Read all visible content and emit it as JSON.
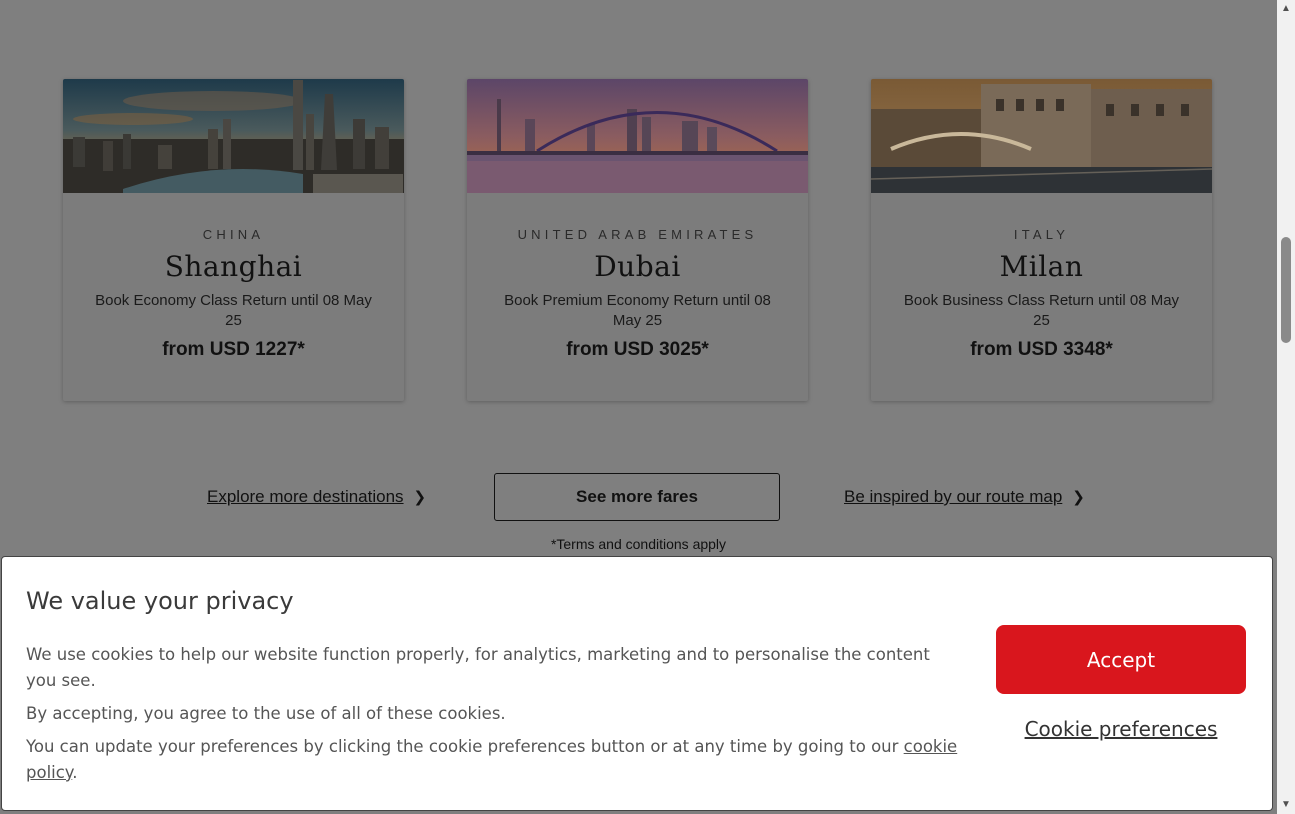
{
  "cards": [
    {
      "country": "CHINA",
      "city": "Shanghai",
      "description": "Book Economy Class Return until 08 May 25",
      "price": "from USD 1227*",
      "image": "shanghai-skyline-image"
    },
    {
      "country": "UNITED ARAB EMIRATES",
      "city": "Dubai",
      "description": "Book Premium Economy Return until 08 May 25",
      "price": "from USD 3025*",
      "image": "dubai-bridge-image"
    },
    {
      "country": "ITALY",
      "city": "Milan",
      "description": "Book Business Class Return until 08 May 25",
      "price": "from USD 3348*",
      "image": "milan-canal-image"
    }
  ],
  "links": {
    "explore": "Explore more destinations",
    "see_more": "See more fares",
    "route_map": "Be inspired by our route map",
    "chevron_icon": "chevron-right-icon"
  },
  "terms": "*Terms and conditions apply",
  "cookie": {
    "title": "We value your privacy",
    "p1": "We use cookies to help our website function properly, for analytics, marketing and to personalise the content you see.",
    "p2": "By accepting, you agree to the use of all of these cookies.",
    "p3_prefix": "You can update your preferences by clicking the cookie preferences button or at any time by going to our ",
    "p3_link": "cookie policy",
    "p3_suffix": ".",
    "accept_label": "Accept",
    "preferences_label": "Cookie preferences",
    "accent_color": "#d9161d"
  },
  "colors": {
    "overlay": "#7f7f7f",
    "accept": "#d9161d"
  }
}
